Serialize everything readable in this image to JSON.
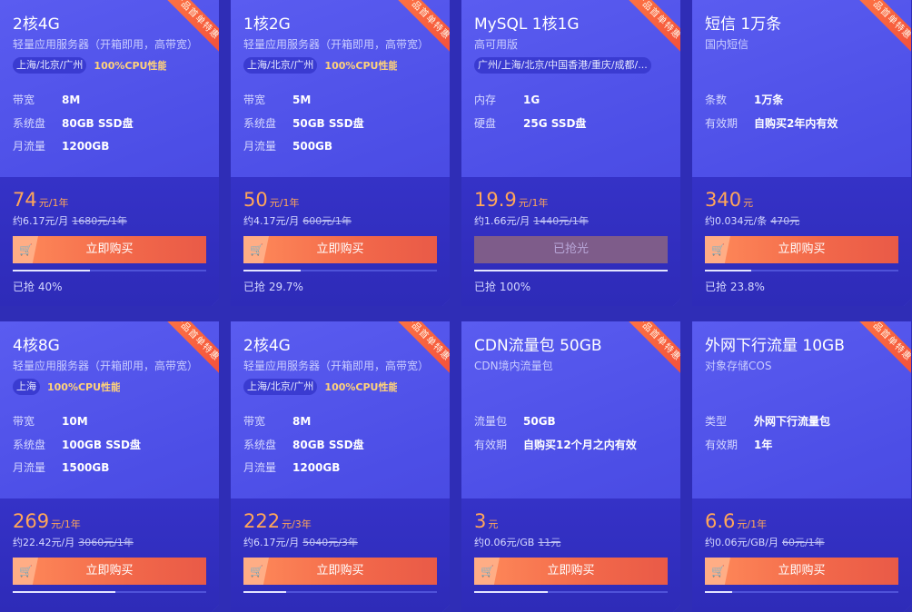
{
  "badge": "产品首单特惠",
  "buy_label": "立即购买",
  "soldout_label": "已抢光",
  "cards": [
    {
      "title": "2核4G",
      "subtitle": "轻量应用服务器（开箱即用，高带宽）",
      "region": "上海/北京/广州",
      "cpu": "100%CPU性能",
      "specs": [
        {
          "label": "带宽",
          "value": "8M"
        },
        {
          "label": "系统盘",
          "value": "80GB SSD盘"
        },
        {
          "label": "月流量",
          "value": "1200GB"
        }
      ],
      "price": "74",
      "price_unit": "元/1年",
      "per": "约6.17元/月",
      "orig": "1680元/1年",
      "progress": 40,
      "sold": "已抢 40%",
      "soldout": false
    },
    {
      "title": "1核2G",
      "subtitle": "轻量应用服务器（开箱即用，高带宽）",
      "region": "上海/北京/广州",
      "cpu": "100%CPU性能",
      "specs": [
        {
          "label": "带宽",
          "value": "5M"
        },
        {
          "label": "系统盘",
          "value": "50GB SSD盘"
        },
        {
          "label": "月流量",
          "value": "500GB"
        }
      ],
      "price": "50",
      "price_unit": "元/1年",
      "per": "约4.17元/月",
      "orig": "600元/1年",
      "progress": 29.7,
      "sold": "已抢 29.7%",
      "soldout": false
    },
    {
      "title": "MySQL 1核1G",
      "subtitle": "高可用版",
      "region": "广州/上海/北京/中国香港/重庆/成都/...",
      "cpu": "",
      "specs": [
        {
          "label": "内存",
          "value": "1G"
        },
        {
          "label": "硬盘",
          "value": "25G SSD盘"
        }
      ],
      "price": "19.9",
      "price_unit": "元/1年",
      "per": "约1.66元/月",
      "orig": "1440元/1年",
      "progress": 100,
      "sold": "已抢 100%",
      "soldout": true
    },
    {
      "title": "短信 1万条",
      "subtitle": "国内短信",
      "region": "",
      "cpu": "",
      "specs": [
        {
          "label": "条数",
          "value": "1万条"
        },
        {
          "label": "有效期",
          "value": "自购买2年内有效"
        }
      ],
      "price": "340",
      "price_unit": "元",
      "per": "约0.034元/条",
      "orig": "470元",
      "progress": 23.8,
      "sold": "已抢 23.8%",
      "soldout": false
    },
    {
      "title": "4核8G",
      "subtitle": "轻量应用服务器（开箱即用，高带宽）",
      "region": "上海",
      "cpu": "100%CPU性能",
      "specs": [
        {
          "label": "带宽",
          "value": "10M"
        },
        {
          "label": "系统盘",
          "value": "100GB SSD盘"
        },
        {
          "label": "月流量",
          "value": "1500GB"
        }
      ],
      "price": "269",
      "price_unit": "元/1年",
      "per": "约22.42元/月",
      "orig": "3060元/1年",
      "progress": 53,
      "sold": "",
      "soldout": false
    },
    {
      "title": "2核4G",
      "subtitle": "轻量应用服务器（开箱即用，高带宽）",
      "region": "上海/北京/广州",
      "cpu": "100%CPU性能",
      "specs": [
        {
          "label": "带宽",
          "value": "8M"
        },
        {
          "label": "系统盘",
          "value": "80GB SSD盘"
        },
        {
          "label": "月流量",
          "value": "1200GB"
        }
      ],
      "price": "222",
      "price_unit": "元/3年",
      "per": "约6.17元/月",
      "orig": "5040元/3年",
      "progress": 22,
      "sold": "",
      "soldout": false
    },
    {
      "title": "CDN流量包 50GB",
      "subtitle": "CDN境内流量包",
      "region": "",
      "cpu": "",
      "specs": [
        {
          "label": "流量包",
          "value": "50GB"
        },
        {
          "label": "有效期",
          "value": "自购买12个月之内有效"
        }
      ],
      "price": "3",
      "price_unit": "元",
      "per": "约0.06元/GB",
      "orig": "11元",
      "progress": 38,
      "sold": "",
      "soldout": false
    },
    {
      "title": "外网下行流量 10GB",
      "subtitle": "对象存储COS",
      "region": "",
      "cpu": "",
      "specs": [
        {
          "label": "类型",
          "value": "外网下行流量包"
        },
        {
          "label": "有效期",
          "value": "1年"
        }
      ],
      "price": "6.6",
      "price_unit": "元/1年",
      "per": "约0.06元/GB/月",
      "orig": "60元/1年",
      "progress": 14,
      "sold": "",
      "soldout": false
    }
  ]
}
